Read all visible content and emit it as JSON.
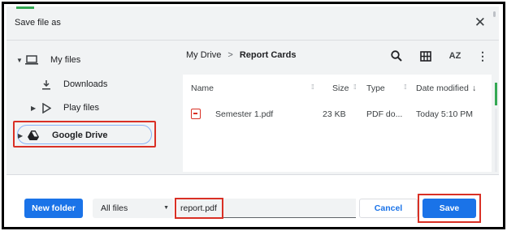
{
  "dialog": {
    "title": "Save file as",
    "close_icon": "close-icon"
  },
  "sidebar": {
    "items": [
      {
        "label": "My files",
        "icon": "laptop-icon",
        "expanded": true
      },
      {
        "label": "Downloads",
        "icon": "download-icon"
      },
      {
        "label": "Play files",
        "icon": "play-store-icon",
        "expanded": false
      },
      {
        "label": "Google Drive",
        "icon": "google-drive-icon",
        "expanded": false,
        "selected": true
      }
    ]
  },
  "breadcrumb": {
    "parent": "My Drive",
    "separator": ">",
    "current": "Report Cards"
  },
  "toolbar": {
    "search_icon": "search-icon",
    "grid_icon": "grid-view-icon",
    "sort_icon": "sort-az-icon",
    "sort_label": "AZ",
    "more_icon": "more-vert-icon"
  },
  "file_list": {
    "columns": [
      "Name",
      "Size",
      "Type",
      "Date modified"
    ],
    "sort_arrow": "↓",
    "rows": [
      {
        "name": "Semester 1.pdf",
        "size": "23 KB",
        "type": "PDF do...",
        "date": "Today 5:10 PM",
        "icon": "pdf-icon"
      }
    ]
  },
  "footer": {
    "new_folder_label": "New folder",
    "file_type_selected": "All files",
    "filename_value": "report.pdf",
    "cancel_label": "Cancel",
    "save_label": "Save"
  },
  "colors": {
    "accent": "#1a73e8",
    "highlight": "#d93025",
    "progress_green": "#34a853"
  }
}
